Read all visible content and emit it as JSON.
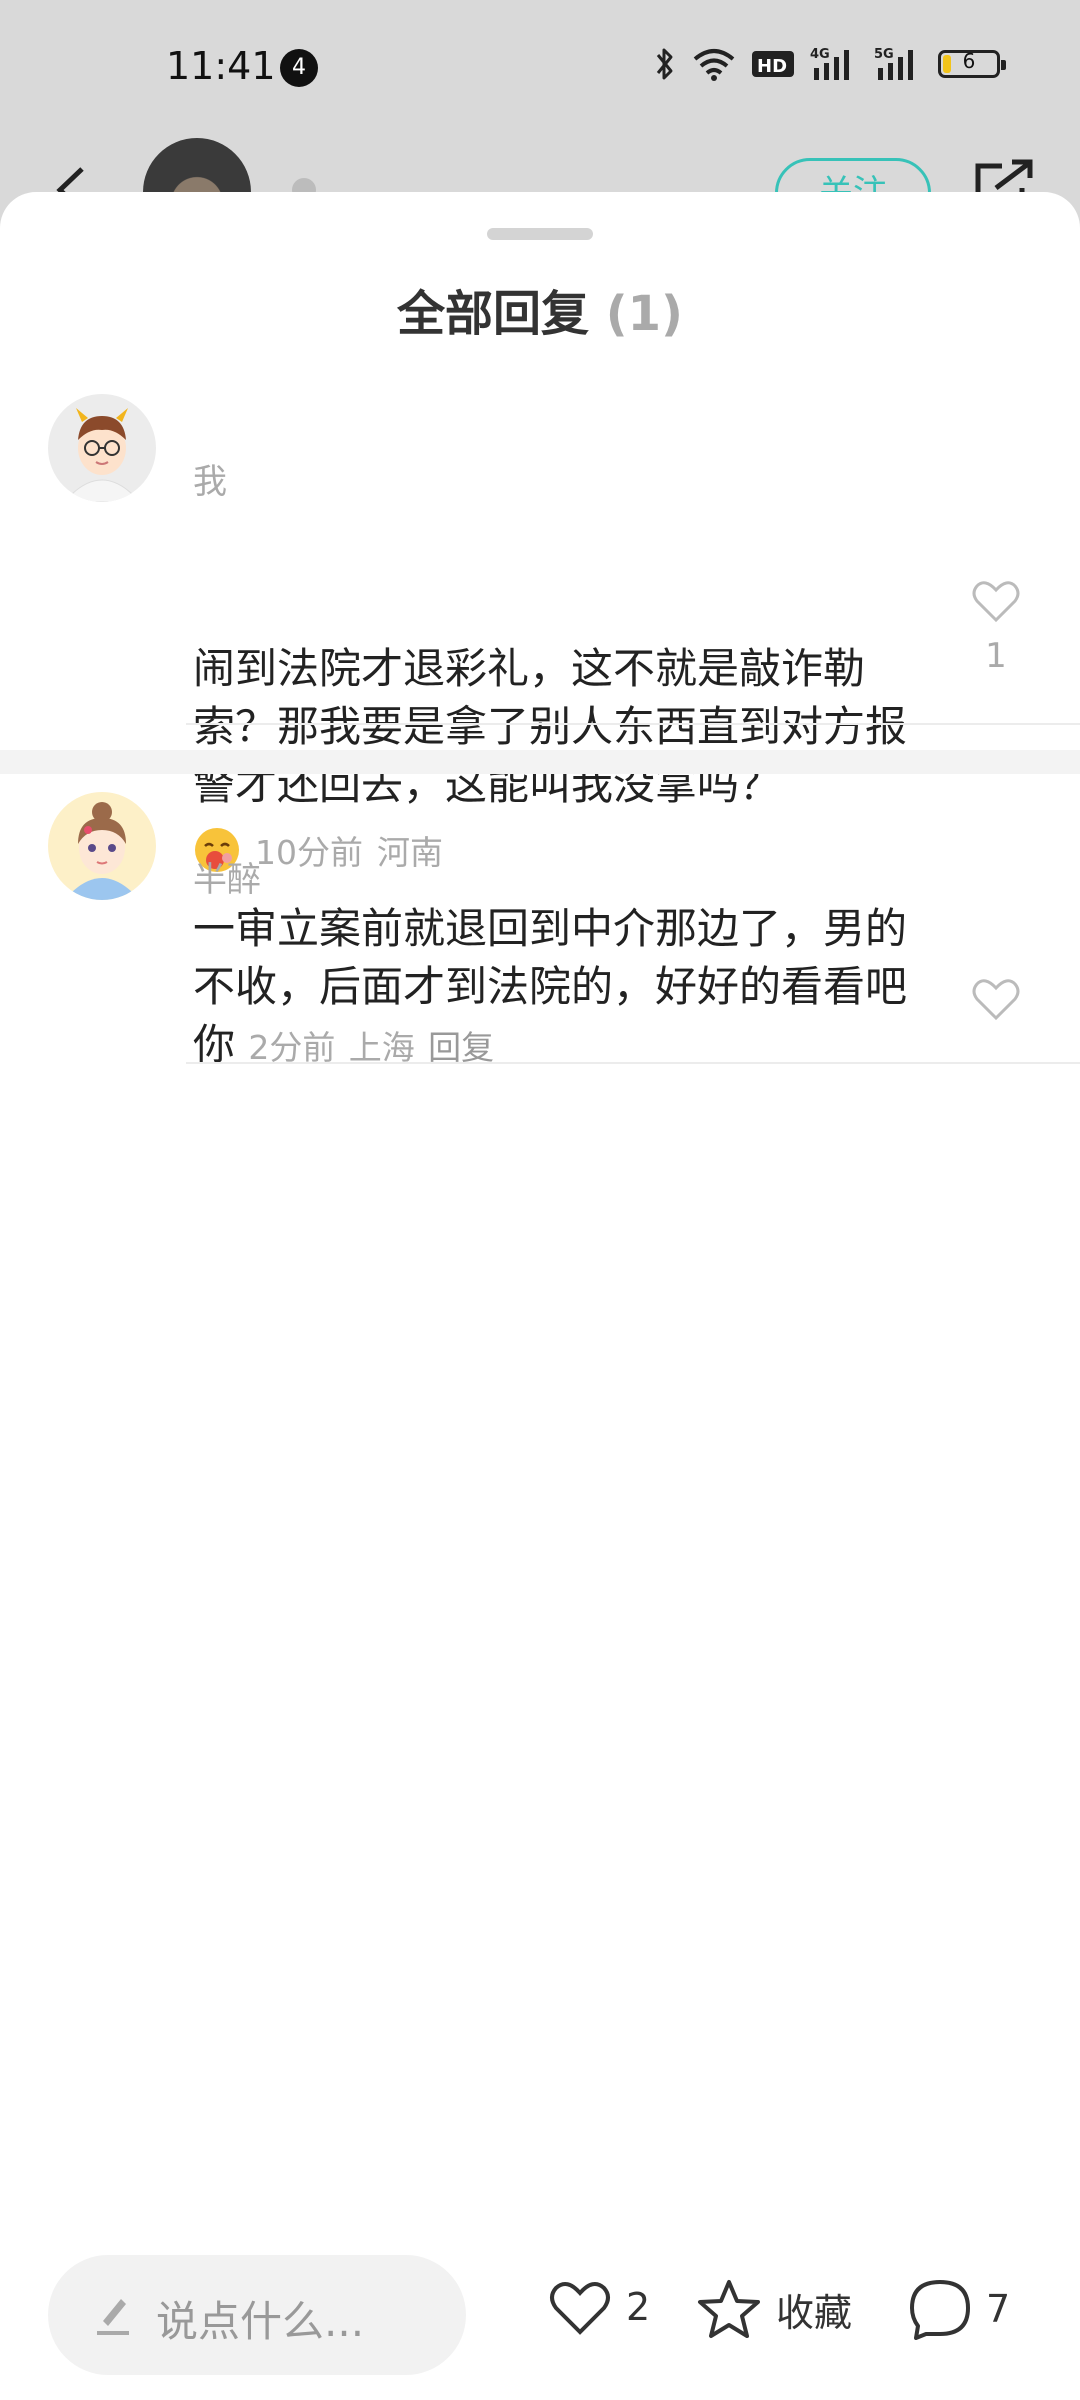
{
  "status_bar": {
    "time": "11:41",
    "notification_count": "4",
    "battery_level": "6"
  },
  "header": {
    "follow_label": "关注"
  },
  "sheet": {
    "title": "全部回复",
    "count": "(1)"
  },
  "comments": [
    {
      "user": "我",
      "text": "闹到法院才退彩礼，这不就是敲诈勒索？那我要是拿了别人东西直到对方报警才还回去，这能叫我没拿吗？",
      "time": "10分前",
      "location": "河南",
      "likes": "1"
    },
    {
      "user": "半醉",
      "text": "一审立案前就退回到中介那边了，男的不收，后面才到法院的，好好的看看吧你",
      "time": "2分前",
      "location": "上海",
      "reply_label": "回复"
    }
  ],
  "bottom_bar": {
    "input_placeholder": "说点什么...",
    "like_count": "2",
    "favorite_label": "收藏",
    "comment_count": "7"
  },
  "colors": {
    "accent": "#37c2b8",
    "muted_text": "#aaaaaa"
  }
}
